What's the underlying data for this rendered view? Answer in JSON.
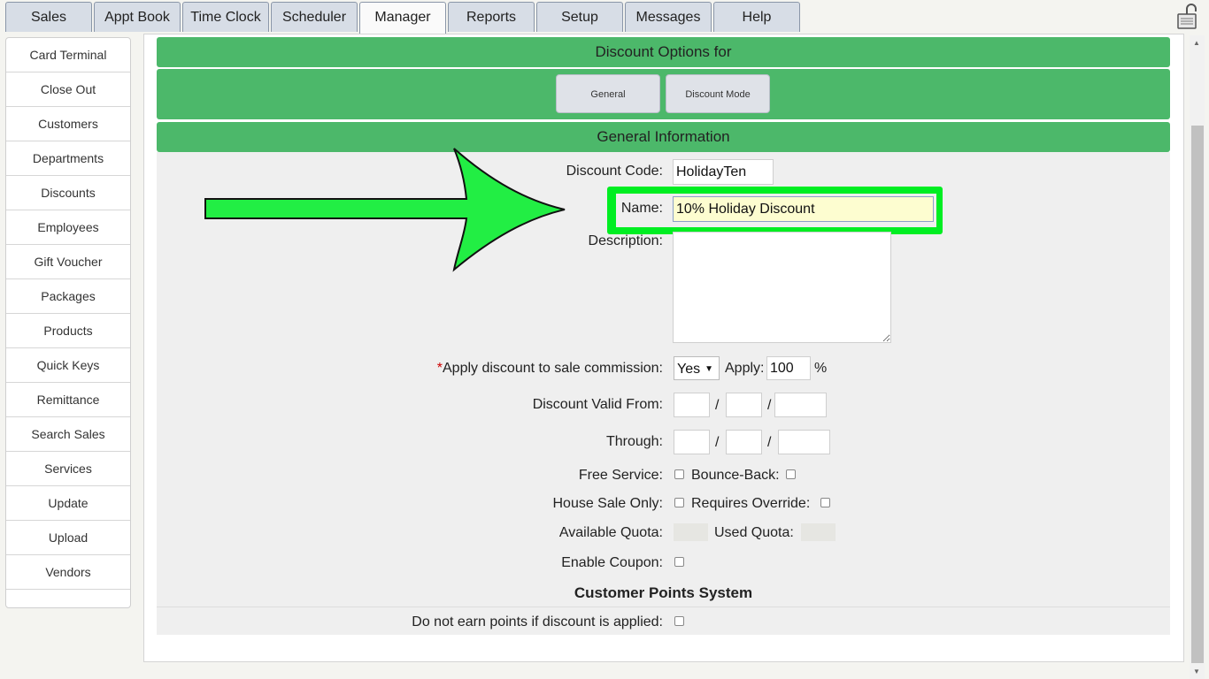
{
  "tabs": [
    {
      "label": "Sales"
    },
    {
      "label": "Appt Book"
    },
    {
      "label": "Time Clock"
    },
    {
      "label": "Scheduler"
    },
    {
      "label": "Manager"
    },
    {
      "label": "Reports"
    },
    {
      "label": "Setup"
    },
    {
      "label": "Messages"
    },
    {
      "label": "Help"
    }
  ],
  "active_tab": "Manager",
  "sidebar": {
    "items": [
      {
        "label": "Card Terminal"
      },
      {
        "label": "Close Out"
      },
      {
        "label": "Customers"
      },
      {
        "label": "Departments"
      },
      {
        "label": "Discounts"
      },
      {
        "label": "Employees"
      },
      {
        "label": "Gift Voucher"
      },
      {
        "label": "Packages"
      },
      {
        "label": "Products"
      },
      {
        "label": "Quick Keys"
      },
      {
        "label": "Remittance"
      },
      {
        "label": "Search Sales"
      },
      {
        "label": "Services"
      },
      {
        "label": "Update"
      },
      {
        "label": "Upload"
      },
      {
        "label": "Vendors"
      }
    ]
  },
  "main": {
    "options_title": "Discount Options for",
    "buttons": {
      "general": "General",
      "discount_mode": "Discount Mode"
    },
    "section_title": "General Information",
    "fields": {
      "discount_code_label": "Discount Code:",
      "discount_code_value": "HolidayTen",
      "name_label": "Name:",
      "name_value": "10% Holiday Discount",
      "description_label": "Description:",
      "description_value": "",
      "commission_required": "*",
      "commission_label": "Apply discount to sale commission:",
      "commission_select": "Yes",
      "apply_label": "Apply:",
      "apply_value": "100",
      "percent_sign": "%",
      "valid_from_label": "Discount Valid From:",
      "through_label": "Through:",
      "date_separator": "/",
      "free_service_label": "Free Service:",
      "bounce_back_label": "Bounce-Back:",
      "house_sale_label": "House Sale Only:",
      "requires_override_label": "Requires Override:",
      "available_quota_label": "Available Quota:",
      "used_quota_label": "Used Quota:",
      "enable_coupon_label": "Enable Coupon:"
    },
    "points_title": "Customer Points System",
    "no_points_label": "Do not earn points if discount is applied:"
  },
  "colors": {
    "header_green": "#4cb86a",
    "highlight_green": "#00ee22",
    "arrow_green": "#22ee44",
    "name_field_bg": "#fdfdd0"
  },
  "icons": {
    "lock": "lock-icon",
    "select_arrow": "triangle-down-icon"
  }
}
